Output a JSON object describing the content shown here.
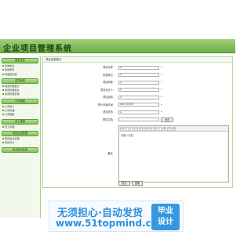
{
  "app": {
    "title": "企业项目管理系统"
  },
  "sidebar": {
    "sections": [
      {
        "title": "基本信息",
        "items": [
          "系统信息",
          "修改密码",
          "管理员管理"
        ]
      },
      {
        "title": "成员管理",
        "items": [
          "成员管理登记",
          "成员管理信息",
          "成员管理查询"
        ]
      },
      {
        "title": "公司管理",
        "items": [
          "公司简介",
          "公司管理",
          "公司规章"
        ]
      },
      {
        "title": "员工管理",
        "items": [
          "员工管理"
        ]
      },
      {
        "title": "项目信息管理",
        "items": [
          "项目信息管理",
          "项目评分"
        ]
      },
      {
        "title": "安全退出系统",
        "items": []
      }
    ]
  },
  "main": {
    "breadcrumb": "项目信息登记",
    "fields": [
      {
        "label": "项目名称：",
        "value": "a",
        "required": true
      },
      {
        "label": "所属单位：",
        "value": "a",
        "required": true
      },
      {
        "label": "项目简称：",
        "value": "a",
        "required": true
      },
      {
        "label": "项目负责人：",
        "value": "a",
        "required": true
      },
      {
        "label": "项目经费：",
        "value": "a",
        "required": true
      },
      {
        "label": "预计开始时间：",
        "value": "2017-03-07",
        "required": true
      },
      {
        "label": "项目状态：",
        "value": "a",
        "required": true
      },
      {
        "label": "附件文档：",
        "value": "",
        "required": false
      }
    ],
    "browse_label": "浏览",
    "editor": {
      "label": "备注：",
      "toolbar": [
        "B",
        "I",
        "U",
        "S",
        "A",
        "≡",
        "≡",
        "≡",
        "•",
        "#",
        "🔗",
        "⊟"
      ],
      "content": "请输入内容"
    },
    "submit_label": "提交",
    "reset_label": "重置"
  },
  "ad": {
    "headline": "无须担心·自动发货",
    "url": "www.51topmind.com",
    "badge_line1": "毕业",
    "badge_line2": "设计"
  }
}
